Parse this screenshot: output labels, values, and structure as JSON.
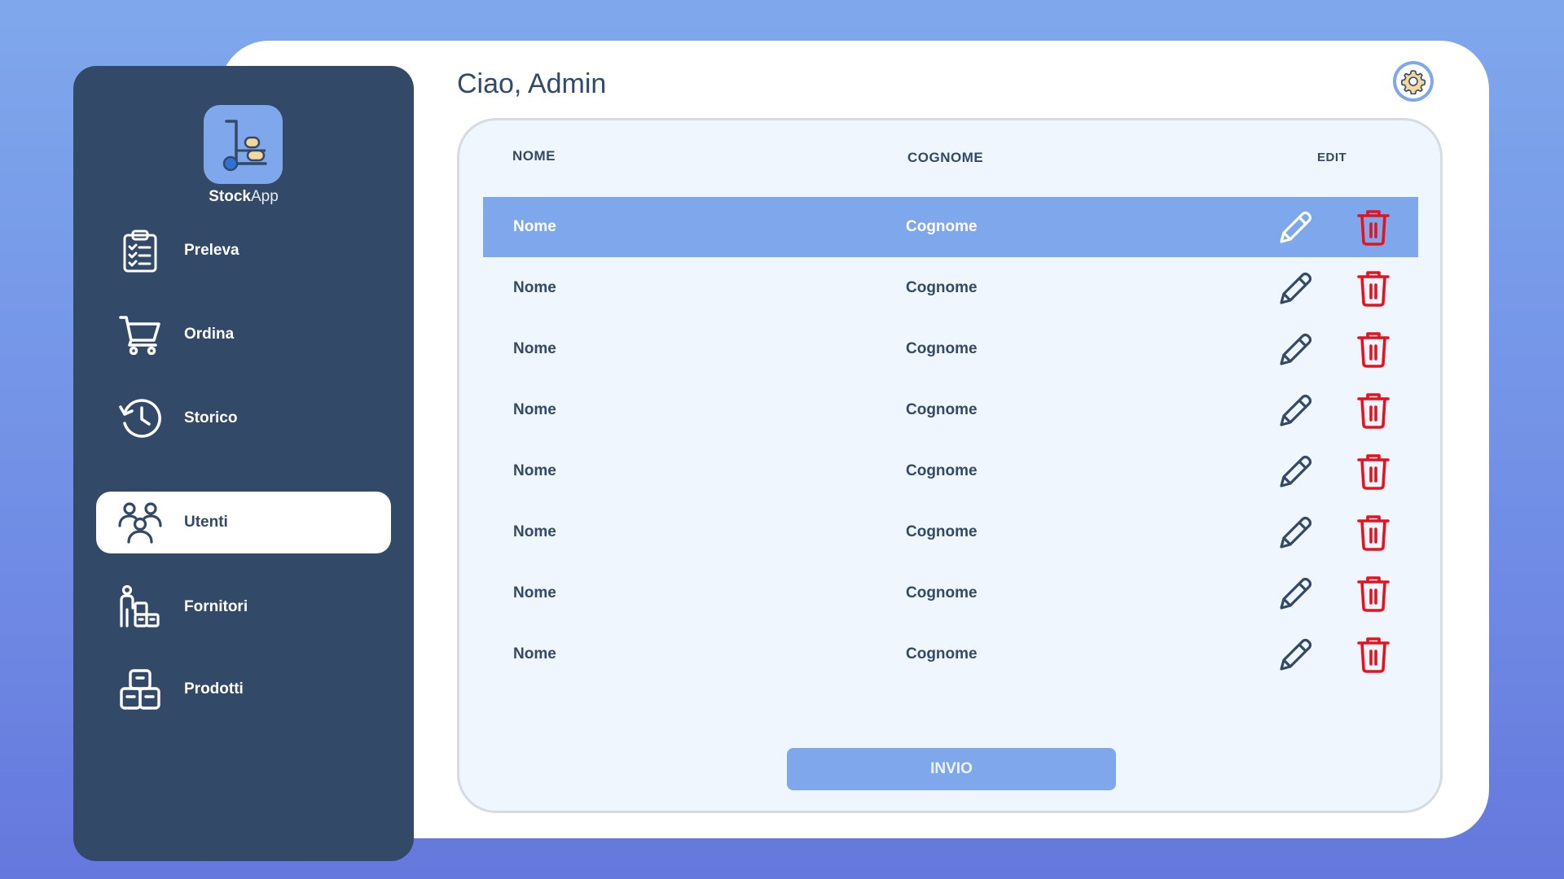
{
  "app": {
    "name_bold": "Stock",
    "name_light": "App"
  },
  "header": {
    "greeting": "Ciao, Admin"
  },
  "sidebar": {
    "items": [
      {
        "label": "Preleva",
        "icon": "clipboard-checklist-icon",
        "active": false
      },
      {
        "label": "Ordina",
        "icon": "shopping-cart-icon",
        "active": false
      },
      {
        "label": "Storico",
        "icon": "history-clock-icon",
        "active": false
      },
      {
        "label": "Utenti",
        "icon": "users-group-icon",
        "active": true
      },
      {
        "label": "Fornitori",
        "icon": "supplier-boxes-icon",
        "active": false
      },
      {
        "label": "Prodotti",
        "icon": "product-boxes-icon",
        "active": false
      }
    ]
  },
  "table": {
    "columns": {
      "nome": "NOME",
      "cognome": "COGNOME",
      "edit": "EDIT"
    },
    "rows": [
      {
        "nome": "Nome",
        "cognome": "Cognome",
        "selected": true
      },
      {
        "nome": "Nome",
        "cognome": "Cognome",
        "selected": false
      },
      {
        "nome": "Nome",
        "cognome": "Cognome",
        "selected": false
      },
      {
        "nome": "Nome",
        "cognome": "Cognome",
        "selected": false
      },
      {
        "nome": "Nome",
        "cognome": "Cognome",
        "selected": false
      },
      {
        "nome": "Nome",
        "cognome": "Cognome",
        "selected": false
      },
      {
        "nome": "Nome",
        "cognome": "Cognome",
        "selected": false
      },
      {
        "nome": "Nome",
        "cognome": "Cognome",
        "selected": false
      }
    ]
  },
  "actions": {
    "submit_label": "INVIO"
  },
  "colors": {
    "sidebar_bg": "#324a68",
    "accent": "#7ea7ec",
    "delete": "#e8121f",
    "panel_bg": "#eff6fd"
  },
  "icons": {
    "settings": "gear-icon",
    "logo": "hand-truck-icon",
    "edit": "pencil-icon",
    "delete": "trash-icon"
  }
}
